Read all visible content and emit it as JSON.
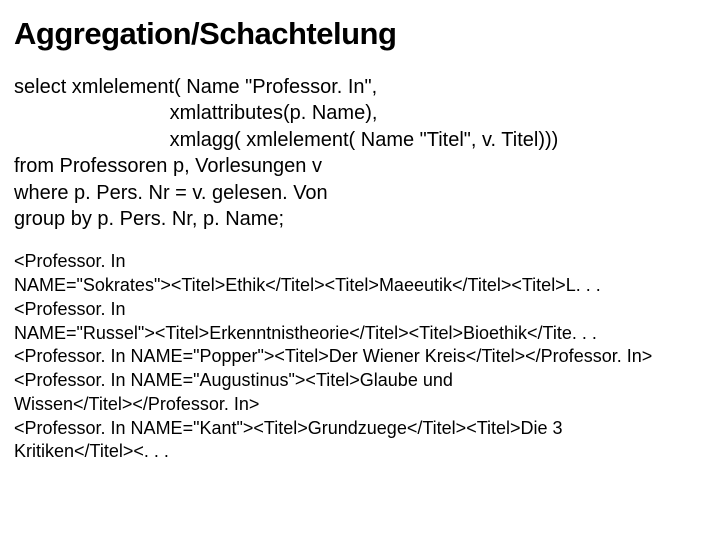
{
  "heading": "Aggregation/Schachtelung",
  "sql_block": "select xmlelement( Name \"Professor. In\",\n                            xmlattributes(p. Name),\n                            xmlagg( xmlelement( Name \"Titel\", v. Titel)))\nfrom Professoren p, Vorlesungen v\nwhere p. Pers. Nr = v. gelesen. Von\ngroup by p. Pers. Nr, p. Name;",
  "xml_block": "<Professor. In\nNAME=\"Sokrates\"><Titel>Ethik</Titel><Titel>Maeeutik</Titel><Titel>L. . .\n<Professor. In\nNAME=\"Russel\"><Titel>Erkenntnistheorie</Titel><Titel>Bioethik</Tite. . .\n<Professor. In NAME=\"Popper\"><Titel>Der Wiener Kreis</Titel></Professor. In>\n<Professor. In NAME=\"Augustinus\"><Titel>Glaube und\nWissen</Titel></Professor. In>\n<Professor. In NAME=\"Kant\"><Titel>Grundzuege</Titel><Titel>Die 3\nKritiken</Titel><. . ."
}
